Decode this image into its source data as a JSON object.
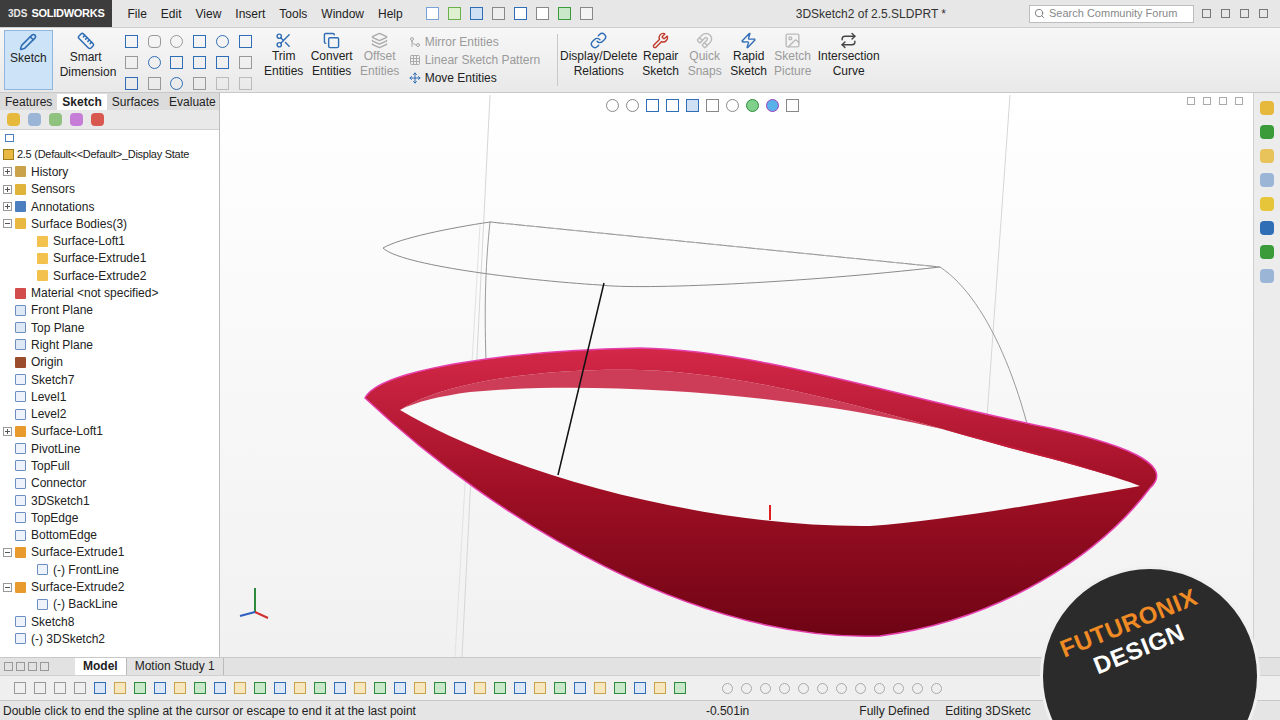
{
  "window": {
    "title": "3DSketch2 of 2.5.SLDPRT *",
    "app": "SOLIDWORKS",
    "brand": "3DS"
  },
  "menu": [
    "File",
    "Edit",
    "View",
    "Insert",
    "Tools",
    "Window",
    "Help"
  ],
  "search": {
    "placeholder": "Search Community Forum"
  },
  "ribbon_left": [
    {
      "label": "Sketch",
      "selected": true,
      "disabled": false
    },
    {
      "label": "Smart Dimension",
      "selected": false,
      "disabled": false
    }
  ],
  "ribbon_mid": [
    {
      "label": "Trim Entities",
      "disabled": false
    },
    {
      "label": "Convert Entities",
      "disabled": false
    },
    {
      "label": "Offset Entities",
      "disabled": true
    }
  ],
  "ribbon_small": [
    {
      "label": "Mirror Entities",
      "disabled": true
    },
    {
      "label": "Linear Sketch Pattern",
      "disabled": true
    },
    {
      "label": "Move Entities",
      "disabled": false
    }
  ],
  "ribbon_right": [
    {
      "label": "Display/Delete Relations",
      "disabled": false
    },
    {
      "label": "Repair Sketch",
      "disabled": false
    },
    {
      "label": "Quick Snaps",
      "disabled": true
    },
    {
      "label": "Rapid Sketch",
      "disabled": false
    },
    {
      "label": "Sketch Picture",
      "disabled": true
    },
    {
      "label": "Intersection Curve",
      "disabled": false
    }
  ],
  "command_tabs": [
    {
      "label": "Features",
      "selected": false
    },
    {
      "label": "Sketch",
      "selected": true
    },
    {
      "label": "Surfaces",
      "selected": false
    },
    {
      "label": "Evaluate",
      "selected": false
    }
  ],
  "tree": {
    "root": "2.5  (Default<<Default>_Display State",
    "items": [
      {
        "label": "History",
        "depth": 0,
        "kind": "history",
        "expander": "closed"
      },
      {
        "label": "Sensors",
        "depth": 0,
        "kind": "sensor",
        "expander": "closed"
      },
      {
        "label": "Annotations",
        "depth": 0,
        "kind": "annotation",
        "expander": "closed"
      },
      {
        "label": "Surface Bodies(3)",
        "depth": 0,
        "kind": "folder",
        "expander": "open"
      },
      {
        "label": "Surface-Loft1",
        "depth": 1,
        "kind": "surface",
        "expander": "none"
      },
      {
        "label": "Surface-Extrude1",
        "depth": 1,
        "kind": "surface",
        "expander": "none"
      },
      {
        "label": "Surface-Extrude2",
        "depth": 1,
        "kind": "surface",
        "expander": "none"
      },
      {
        "label": "Material <not specified>",
        "depth": 0,
        "kind": "material",
        "expander": "none"
      },
      {
        "label": "Front Plane",
        "depth": 0,
        "kind": "plane",
        "expander": "none"
      },
      {
        "label": "Top Plane",
        "depth": 0,
        "kind": "plane",
        "expander": "none"
      },
      {
        "label": "Right Plane",
        "depth": 0,
        "kind": "plane",
        "expander": "none"
      },
      {
        "label": "Origin",
        "depth": 0,
        "kind": "origin",
        "expander": "none"
      },
      {
        "label": "Sketch7",
        "depth": 0,
        "kind": "sketch",
        "expander": "none"
      },
      {
        "label": "Level1",
        "depth": 0,
        "kind": "sketch",
        "expander": "none"
      },
      {
        "label": "Level2",
        "depth": 0,
        "kind": "sketch",
        "expander": "none"
      },
      {
        "label": "Surface-Loft1",
        "depth": 0,
        "kind": "feature",
        "expander": "closed"
      },
      {
        "label": "PivotLine",
        "depth": 0,
        "kind": "sketch",
        "expander": "none"
      },
      {
        "label": "TopFull",
        "depth": 0,
        "kind": "sketch",
        "expander": "none"
      },
      {
        "label": "Connector",
        "depth": 0,
        "kind": "sketch",
        "expander": "none"
      },
      {
        "label": "3DSketch1",
        "depth": 0,
        "kind": "sketch",
        "expander": "none"
      },
      {
        "label": "TopEdge",
        "depth": 0,
        "kind": "sketch",
        "expander": "none"
      },
      {
        "label": "BottomEdge",
        "depth": 0,
        "kind": "sketch",
        "expander": "none"
      },
      {
        "label": "Surface-Extrude1",
        "depth": 0,
        "kind": "feature",
        "expander": "open"
      },
      {
        "label": "(-) FrontLine",
        "depth": 1,
        "kind": "sketch",
        "expander": "none"
      },
      {
        "label": "Surface-Extrude2",
        "depth": 0,
        "kind": "feature",
        "expander": "open"
      },
      {
        "label": "(-) BackLine",
        "depth": 1,
        "kind": "sketch",
        "expander": "none"
      },
      {
        "label": "Sketch8",
        "depth": 0,
        "kind": "sketch",
        "expander": "none"
      },
      {
        "label": "(-) 3DSketch2",
        "depth": 0,
        "kind": "sketch",
        "expander": "none"
      }
    ]
  },
  "bottom_tabs": [
    {
      "label": "Model",
      "selected": true
    },
    {
      "label": "Motion Study 1",
      "selected": false
    }
  ],
  "status_bar": {
    "hint": "Double click to end the spline at the cursor or escape to end it at the last point",
    "coordinate": "-0.501in",
    "state": "Fully Defined",
    "mode": "Editing 3DSketc"
  },
  "watermark": {
    "line1": "FUTURONIX",
    "line2": "DESIGN"
  }
}
